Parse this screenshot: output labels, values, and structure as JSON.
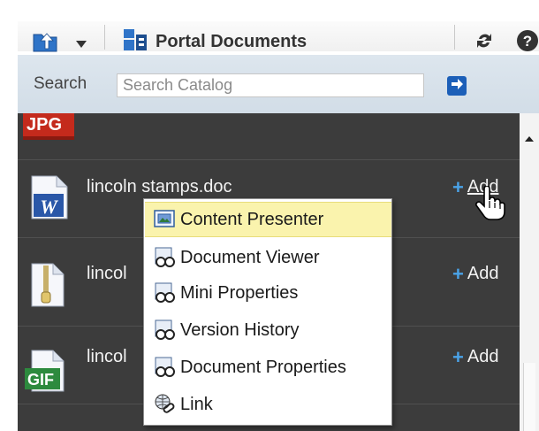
{
  "toolbar": {
    "title": "Portal Documents",
    "buttons": [
      "upload-icon",
      "dropdown-arrow-icon",
      "refresh-icon",
      "help-icon"
    ]
  },
  "search": {
    "label": "Search",
    "placeholder": "Search Catalog"
  },
  "files": [
    {
      "badge": "JPG",
      "name": "",
      "add_label": ""
    },
    {
      "badge": "",
      "name": "lincoln stamps.doc",
      "add_label": "Add"
    },
    {
      "badge": "",
      "name": "lincol",
      "add_label": "Add"
    },
    {
      "badge": "GIF",
      "name": "lincol",
      "add_label": "Add"
    }
  ],
  "menu": {
    "items": [
      {
        "label": "Content Presenter",
        "icon": "content-presenter-icon",
        "active": true
      },
      {
        "label": "Document Viewer",
        "icon": "document-viewer-icon",
        "active": false
      },
      {
        "label": "Mini Properties",
        "icon": "mini-properties-icon",
        "active": false
      },
      {
        "label": "Version History",
        "icon": "version-history-icon",
        "active": false
      },
      {
        "label": "Document Properties",
        "icon": "document-properties-icon",
        "active": false
      },
      {
        "label": "Link",
        "icon": "link-icon",
        "active": false
      }
    ]
  },
  "colors": {
    "panel": "#3c3c3c",
    "accent": "#1c5fb8",
    "menu_highlight": "#faf3ad",
    "add_plus": "#4aa3e8"
  }
}
